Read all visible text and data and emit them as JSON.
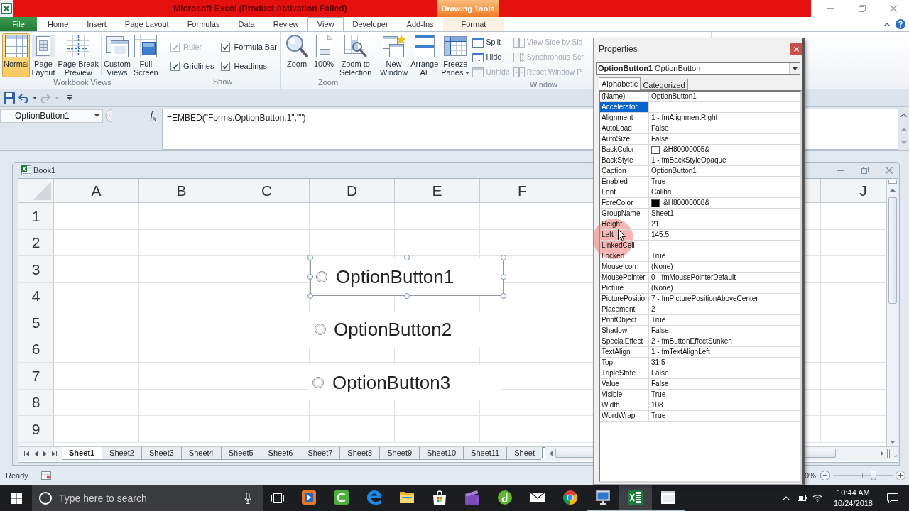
{
  "title_bar": {
    "title": "Microsoft Excel (Product Activation Failed)",
    "context_label": "Drawing Tools"
  },
  "ribbon_tabs": [
    {
      "label": "File",
      "kind": "file",
      "selected": false
    },
    {
      "label": "Home",
      "kind": "tab",
      "selected": false
    },
    {
      "label": "Insert",
      "kind": "tab",
      "selected": false
    },
    {
      "label": "Page Layout",
      "kind": "tab",
      "selected": false
    },
    {
      "label": "Formulas",
      "kind": "tab",
      "selected": false
    },
    {
      "label": "Data",
      "kind": "tab",
      "selected": false
    },
    {
      "label": "Review",
      "kind": "tab",
      "selected": false
    },
    {
      "label": "View",
      "kind": "tab",
      "selected": true
    },
    {
      "label": "Developer",
      "kind": "tab",
      "selected": false
    },
    {
      "label": "Add-Ins",
      "kind": "tab",
      "selected": false
    },
    {
      "label": "Format",
      "kind": "contextual",
      "selected": false
    }
  ],
  "ribbon_groups": [
    {
      "label": "Workbook Views",
      "items": [
        {
          "kind": "large",
          "label": "Normal",
          "selected": true
        },
        {
          "kind": "large",
          "label": "Page\nLayout",
          "selected": false
        },
        {
          "kind": "large",
          "label": "Page Break\nPreview",
          "selected": false
        },
        {
          "kind": "large",
          "label": "Custom\nViews",
          "selected": false
        },
        {
          "kind": "large",
          "label": "Full\nScreen",
          "selected": false
        }
      ]
    },
    {
      "label": "Show",
      "items": [
        {
          "kind": "checkbox",
          "label": "Ruler",
          "checked": true,
          "disabled": true
        },
        {
          "kind": "checkbox",
          "label": "Gridlines",
          "checked": true,
          "disabled": false
        },
        {
          "kind": "checkbox",
          "label": "Formula Bar",
          "checked": true,
          "disabled": false
        },
        {
          "kind": "checkbox",
          "label": "Headings",
          "checked": true,
          "disabled": false
        }
      ]
    },
    {
      "label": "Zoom",
      "items": [
        {
          "kind": "large",
          "label": "Zoom"
        },
        {
          "kind": "large",
          "label": "100%"
        },
        {
          "kind": "large",
          "label": "Zoom to\nSelection"
        }
      ]
    },
    {
      "label": "Window",
      "items": [
        {
          "kind": "large",
          "label": "New\nWindow"
        },
        {
          "kind": "large",
          "label": "Arrange\nAll"
        },
        {
          "kind": "large",
          "label": "Freeze\nPanes",
          "dropdown": true
        },
        {
          "kind": "small",
          "label": "Split",
          "disabled": false
        },
        {
          "kind": "small",
          "label": "Hide",
          "disabled": false
        },
        {
          "kind": "small",
          "label": "Unhide",
          "disabled": true
        },
        {
          "kind": "small",
          "label": "View Side by Sid",
          "disabled": true
        },
        {
          "kind": "small",
          "label": "Synchronous Scr",
          "disabled": true
        },
        {
          "kind": "small",
          "label": "Reset Window P",
          "disabled": true
        }
      ]
    }
  ],
  "quick_access_tools": [
    {
      "disabled": false
    },
    {
      "disabled": false
    },
    {
      "disabled": true
    },
    {
      "disabled": false
    }
  ],
  "formula_bar": {
    "name_box": "OptionButton1",
    "function_button": "f$_{x}$",
    "formula": "=EMBED(\"Forms.OptionButton.1\",\"\")"
  },
  "workbook": {
    "title": "Book1",
    "columns": [
      "A",
      "B",
      "C",
      "D",
      "E",
      "F",
      "J"
    ],
    "rows": [
      "1",
      "2",
      "3",
      "4",
      "5",
      "6",
      "7",
      "8",
      "9"
    ]
  },
  "option_buttons": [
    {
      "caption": "OptionButton1",
      "selected": true,
      "checked": false
    },
    {
      "caption": "OptionButton2",
      "selected": false,
      "checked": false
    },
    {
      "caption": "OptionButton3",
      "selected": false,
      "checked": false
    }
  ],
  "sheet_tabs": [
    {
      "label": "Sheet1",
      "selected": true
    },
    {
      "label": "Sheet2",
      "selected": false
    },
    {
      "label": "Sheet3",
      "selected": false
    },
    {
      "label": "Sheet4",
      "selected": false
    },
    {
      "label": "Sheet5",
      "selected": false
    },
    {
      "label": "Sheet6",
      "selected": false
    },
    {
      "label": "Sheet7",
      "selected": false
    },
    {
      "label": "Sheet8",
      "selected": false
    },
    {
      "label": "Sheet9",
      "selected": false
    },
    {
      "label": "Sheet10",
      "selected": false
    },
    {
      "label": "Sheet11",
      "selected": false
    },
    {
      "label": "Sheet",
      "selected": false
    }
  ],
  "status_bar": {
    "status": "Ready",
    "zoom": "0%",
    "zoom_slider": {
      "level": 0.68
    }
  },
  "properties_window": {
    "title": "Properties",
    "object": "**OptionButton1** OptionButton",
    "tabs": [
      {
        "label": "Alphabetic",
        "selected": true
      },
      {
        "label": "Categorized",
        "selected": false
      }
    ],
    "rows": [
      {
        "name": "(Name)",
        "value": "OptionButton1",
        "selected": false
      },
      {
        "name": "Accelerator",
        "selected": true
      },
      {
        "name": "Alignment",
        "value": "1 - fmAlignmentRight",
        "selected": false
      },
      {
        "name": "AutoLoad",
        "value": "False",
        "selected": false
      },
      {
        "name": "AutoSize",
        "value": "False",
        "selected": false
      },
      {
        "name": "BackColor",
        "value": "&H80000005&",
        "color": "#ffffff",
        "selected": false
      },
      {
        "name": "BackStyle",
        "value": "1 - fmBackStyleOpaque",
        "selected": false
      },
      {
        "name": "Caption",
        "value": "OptionButton1",
        "selected": false
      },
      {
        "name": "Enabled",
        "value": "True",
        "selected": false
      },
      {
        "name": "Font",
        "value": "Calibri",
        "selected": false
      },
      {
        "name": "ForeColor",
        "value": "&H80000008&",
        "color": "#000000",
        "selected": false
      },
      {
        "name": "GroupName",
        "value": "Sheet1",
        "selected": false
      },
      {
        "name": "Height",
        "value": "21",
        "selected": false
      },
      {
        "name": "Left",
        "value": "145.5",
        "selected": false
      },
      {
        "name": "LinkedCell",
        "selected": false
      },
      {
        "name": "Locked",
        "value": "True",
        "selected": false
      },
      {
        "name": "MouseIcon",
        "value": "(None)",
        "selected": false
      },
      {
        "name": "MousePointer",
        "value": "0 - fmMousePointerDefault",
        "selected": false
      },
      {
        "name": "Picture",
        "value": "(None)",
        "selected": false
      },
      {
        "name": "PicturePosition",
        "value": "7 - fmPicturePositionAboveCenter",
        "selected": false
      },
      {
        "name": "Placement",
        "value": "2",
        "selected": false
      },
      {
        "name": "PrintObject",
        "value": "True",
        "selected": false
      },
      {
        "name": "Shadow",
        "value": "False",
        "selected": false
      },
      {
        "name": "SpecialEffect",
        "value": "2 - fmButtonEffectSunken",
        "selected": false
      },
      {
        "name": "TextAlign",
        "value": "1 - fmTextAlignLeft",
        "selected": false
      },
      {
        "name": "Top",
        "value": "31.5",
        "selected": false
      },
      {
        "name": "TripleState",
        "value": "False",
        "selected": false
      },
      {
        "name": "Value",
        "value": "False",
        "selected": false
      },
      {
        "name": "Visible",
        "value": "True",
        "selected": false
      },
      {
        "name": "Width",
        "value": "108",
        "selected": false
      },
      {
        "name": "WordWrap",
        "value": "True",
        "selected": false
      }
    ]
  },
  "taskbar": {
    "search": {
      "placeholder": "Type here to search"
    },
    "apps": [
      {
        "running": false,
        "selected": false
      },
      {
        "running": false,
        "selected": false
      },
      {
        "running": false,
        "selected": false
      },
      {
        "running": false,
        "selected": false
      },
      {
        "running": false,
        "selected": false
      },
      {
        "running": false,
        "selected": false
      },
      {
        "running": false,
        "selected": false
      },
      {
        "running": false,
        "selected": false
      },
      {
        "running": false,
        "selected": false
      },
      {
        "running": true,
        "selected": false
      },
      {
        "running": true,
        "selected": true
      },
      {
        "running": true,
        "selected": false
      }
    ],
    "time": "10:44 AM",
    "date": "10/24/2018"
  }
}
